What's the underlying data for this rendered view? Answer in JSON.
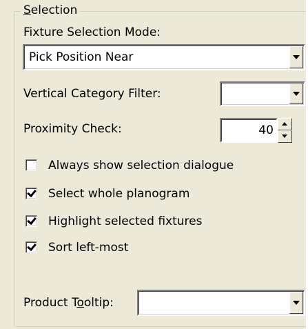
{
  "group": {
    "title_prefix": "",
    "title_accel": "S",
    "title_rest": "election"
  },
  "fixture_selection_mode": {
    "label": "Fixture Selection Mode:",
    "value": "Pick Position Near"
  },
  "vertical_category_filter": {
    "label": "Vertical Category Filter:",
    "value": ""
  },
  "proximity_check": {
    "label": "Proximity Check:",
    "value": "40"
  },
  "checkboxes": [
    {
      "label": "Always show selection dialogue",
      "checked": false
    },
    {
      "label": "Select whole planogram",
      "checked": true
    },
    {
      "label": "Highlight selected fixtures",
      "checked": true
    },
    {
      "label": "Sort left-most",
      "checked": true
    }
  ],
  "product_tooltip": {
    "label_before": "Product T",
    "label_accel": "o",
    "label_after": "oltip:",
    "value": ""
  }
}
